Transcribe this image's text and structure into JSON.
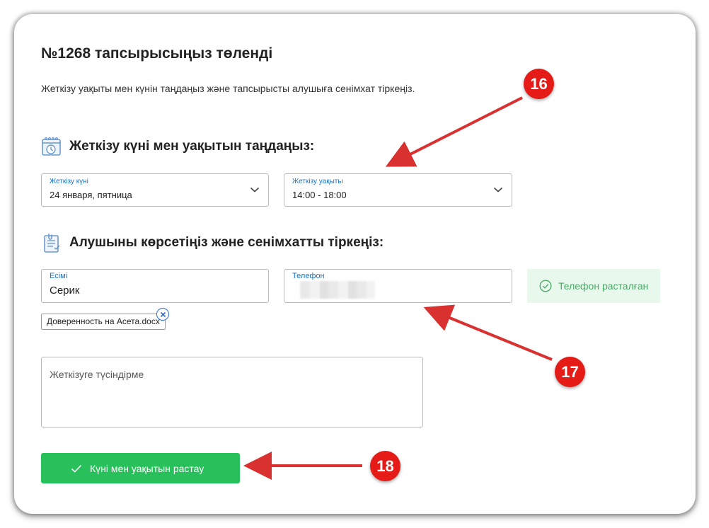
{
  "page": {
    "title": "№1268 тапсырысыңыз төленді",
    "intro": "Жеткізу уақыты мен күнін таңдаңыз және тапсырысты алушыға сенімхат тіркеңіз."
  },
  "delivery_section": {
    "heading": "Жеткізу күні мен уақытын таңдаңыз:",
    "icon": "calendar-clock-icon",
    "date_select": {
      "label": "Жеткізу күні",
      "value": "24 января, пятница"
    },
    "time_select": {
      "label": "Жеткізу уақыты",
      "value": "14:00 - 18:00"
    }
  },
  "recipient_section": {
    "heading": "Алушыны көрсетіңіз және сенімхатты тіркеңіз:",
    "icon": "document-clip-icon",
    "name_field": {
      "label": "Есімі",
      "value": "Серик"
    },
    "phone_field": {
      "label": "Телефон"
    },
    "phone_verified": "Телефон расталған",
    "attached_file": "Доверенность на Асета.docx"
  },
  "comment": {
    "placeholder": "Жеткізуге түсіндірме"
  },
  "confirm_button": {
    "label": "Күні мен уақытын растау"
  },
  "annotations": [
    {
      "number": "16"
    },
    {
      "number": "17"
    },
    {
      "number": "18"
    }
  ],
  "colors": {
    "accent_green": "#27c05b",
    "verified_bg": "#e8f8ec",
    "verified_text": "#4aa966",
    "label_blue": "#1a73c8",
    "annotation_red": "#e41b17"
  }
}
